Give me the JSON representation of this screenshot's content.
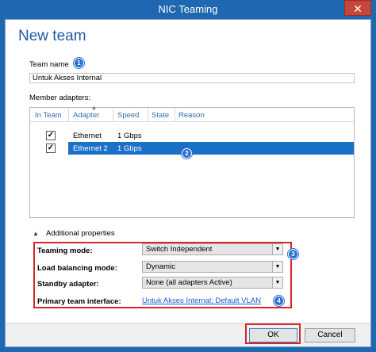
{
  "window": {
    "title": "NIC Teaming",
    "close_glyph": "✕"
  },
  "heading": "New team",
  "team_name": {
    "label": "Team name",
    "value": "Untuk Akses Internal"
  },
  "adapters": {
    "label": "Member adapters:",
    "columns": [
      "In Team",
      "Adapter",
      "Speed",
      "State",
      "Reason"
    ],
    "rows": [
      {
        "in_team": true,
        "adapter": "Ethernet",
        "speed": "1 Gbps",
        "state": "",
        "reason": "",
        "selected": false
      },
      {
        "in_team": true,
        "adapter": "Ethernet 2",
        "speed": "1 Gbps",
        "state": "",
        "reason": "",
        "selected": true
      }
    ]
  },
  "additional_properties": {
    "label": "Additional properties",
    "teaming_mode": {
      "label": "Teaming mode:",
      "value": "Switch Independent"
    },
    "load_balancing": {
      "label": "Load balancing mode:",
      "value": "Dynamic"
    },
    "standby_adapter": {
      "label": "Standby adapter:",
      "value": "None (all adapters Active)"
    },
    "primary_interface": {
      "label": "Primary team interface:",
      "value": "Untuk Akses Internal; Default VLAN"
    }
  },
  "badges": [
    "1",
    "2",
    "3",
    "4"
  ],
  "buttons": {
    "ok": "OK",
    "cancel": "Cancel"
  },
  "colors": {
    "accent": "#1b70c8",
    "title_bar": "#1f67b1",
    "highlight_box": "#d5262a",
    "badge": "#2a6ed6"
  }
}
